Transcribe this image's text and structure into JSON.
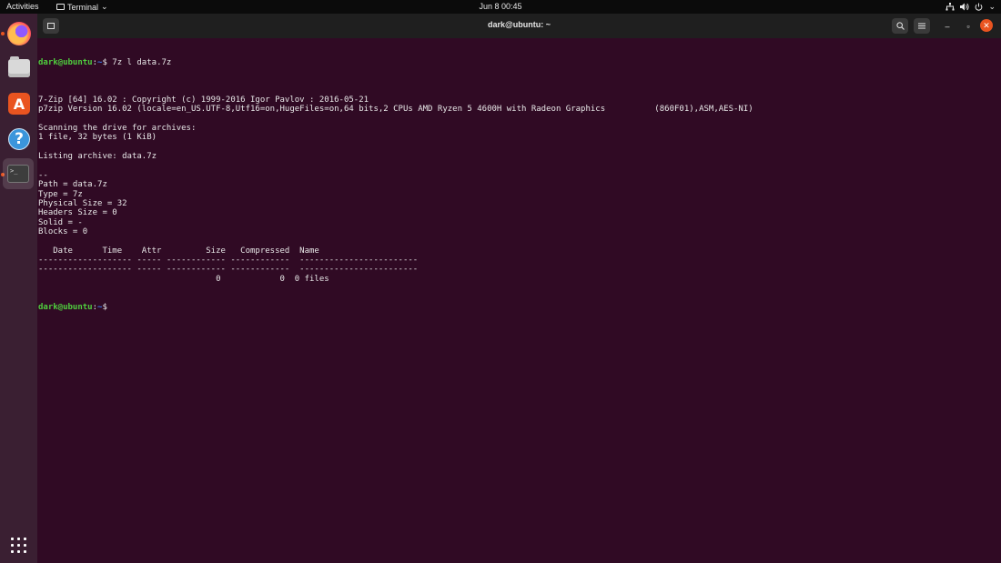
{
  "topbar": {
    "activities": "Activities",
    "app_name": "Terminal",
    "app_chevron": "⌄",
    "clock": "Jun 8  00:45",
    "network_icon": "network-icon",
    "volume_icon": "volume-icon",
    "power_icon": "power-icon",
    "menu_chevron": "⌄"
  },
  "dock": {
    "items": [
      {
        "name": "firefox",
        "icon": "firefox-icon",
        "running": true
      },
      {
        "name": "files",
        "icon": "files-icon",
        "running": false
      },
      {
        "name": "ubuntu-software",
        "icon": "software-icon",
        "running": false
      },
      {
        "name": "help",
        "icon": "help-icon",
        "running": false
      },
      {
        "name": "terminal",
        "icon": "terminal-icon",
        "running": true,
        "active": true
      }
    ],
    "software_glyph": "A",
    "help_glyph": "?",
    "terminal_glyph": ">_",
    "show_apps_icon": "grid-icon"
  },
  "window": {
    "title": "dark@ubuntu: ~",
    "min_glyph": "–",
    "max_glyph": "▫",
    "close_glyph": "✕"
  },
  "terminal": {
    "prompt_user": "dark@ubuntu",
    "prompt_path": "~",
    "command": "7z l data.7z",
    "lines": [
      "",
      "7-Zip [64] 16.02 : Copyright (c) 1999-2016 Igor Pavlov : 2016-05-21",
      "p7zip Version 16.02 (locale=en_US.UTF-8,Utf16=on,HugeFiles=on,64 bits,2 CPUs AMD Ryzen 5 4600H with Radeon Graphics          (860F01),ASM,AES-NI)",
      "",
      "Scanning the drive for archives:",
      "1 file, 32 bytes (1 KiB)",
      "",
      "Listing archive: data.7z",
      "",
      "--",
      "Path = data.7z",
      "Type = 7z",
      "Physical Size = 32",
      "Headers Size = 0",
      "Solid = -",
      "Blocks = 0",
      "",
      "   Date      Time    Attr         Size   Compressed  Name",
      "------------------- ----- ------------ ------------  ------------------------",
      "------------------- ----- ------------ ------------  ------------------------",
      "                                    0            0  0 files"
    ]
  },
  "colors": {
    "terminal_bg": "#300a24",
    "prompt_user": "#4fce3e",
    "prompt_path": "#3b76e6",
    "accent": "#e95420"
  }
}
